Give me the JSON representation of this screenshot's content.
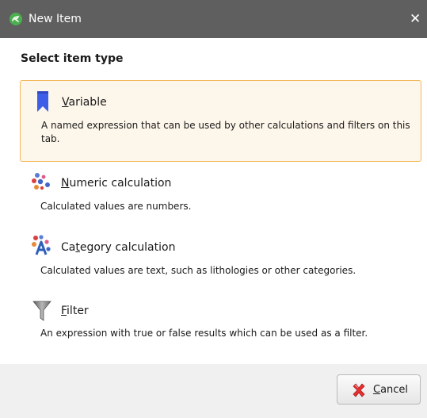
{
  "window": {
    "title": "New Item",
    "close_glyph": "✕",
    "app_icon": "leapfrog-app-icon"
  },
  "heading": "Select item type",
  "options": [
    {
      "label_mnemonic": "V",
      "label_rest": "ariable",
      "description": "A named expression that can be used by other calculations and filters on this tab.",
      "icon": "bookmark-icon",
      "selected": true
    },
    {
      "label_mnemonic": "N",
      "label_rest": "umeric calculation",
      "description": "Calculated values are numbers.",
      "icon": "numeric-molecule-icon",
      "selected": false
    },
    {
      "label_pre": "Ca",
      "label_mnemonic": "t",
      "label_rest": "egory calculation",
      "description": "Calculated values are text, such as lithologies or other categories.",
      "icon": "category-molecule-icon",
      "selected": false
    },
    {
      "label_mnemonic": "F",
      "label_rest": "ilter",
      "description": "An expression with true or false results which can be used as a filter.",
      "icon": "funnel-icon",
      "selected": false
    }
  ],
  "footer": {
    "cancel_mnemonic": "C",
    "cancel_rest": "ancel",
    "cancel_icon": "red-x-icon"
  },
  "colors": {
    "titlebar": "#5f5f5f",
    "selected_border": "#f4b85e",
    "selected_bg": "#fdf6ea",
    "bookmark_blue": "#3e5ee8"
  }
}
